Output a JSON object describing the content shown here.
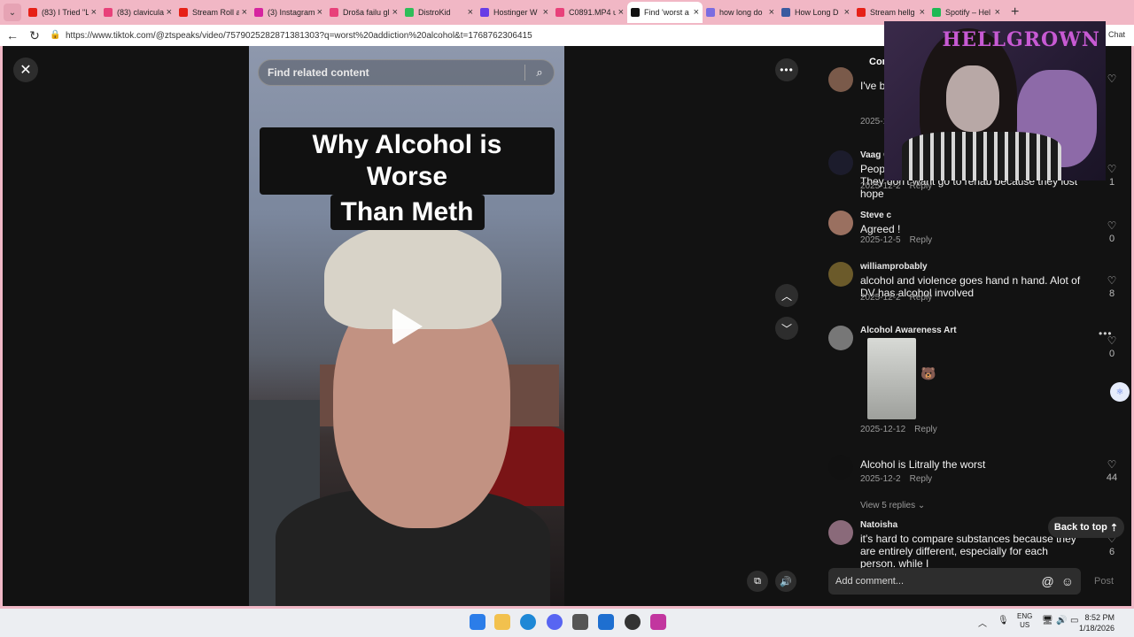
{
  "browser": {
    "tabs": [
      {
        "label": "(83) I Tried \"L",
        "color": "#e62117"
      },
      {
        "label": "(83) clavicula",
        "color": "#e8417a"
      },
      {
        "label": "Stream Roll a",
        "color": "#e62117"
      },
      {
        "label": "(3) Instagram",
        "color": "#d6249f"
      },
      {
        "label": "Droša failu gl",
        "color": "#e8417a"
      },
      {
        "label": "DistroKid",
        "color": "#2ebd59"
      },
      {
        "label": "Hostinger W",
        "color": "#673de6"
      },
      {
        "label": "C0891.MP4 u",
        "color": "#e8417a"
      },
      {
        "label": "Find 'worst a",
        "color": "#111111"
      },
      {
        "label": "how long do",
        "color": "#7b6ce0"
      },
      {
        "label": "How Long D",
        "color": "#3a5ba0"
      },
      {
        "label": "Stream hellg",
        "color": "#e62117"
      },
      {
        "label": "Spotify – Hel",
        "color": "#1db954"
      }
    ],
    "active_tab_index": 8,
    "url": "https://www.tiktok.com/@ztspeaks/video/7579025282871381303?q=worst%20addiction%20alcohol&t=1768762306415",
    "chat_label": "Chat"
  },
  "video": {
    "search_placeholder": "Find related content",
    "caption_line1": "Why Alcohol is Worse",
    "caption_line2": "Than Meth"
  },
  "comments_panel": {
    "tab_label": "Com",
    "comments": [
      {
        "user": "",
        "text": "I've be wisdo say A longe",
        "date": "2025-1",
        "reply": "",
        "likes": ""
      },
      {
        "user": "Vaag C",
        "text": "People (including myself) have sold their soul. They don't want go to rehab because they lost hope",
        "date": "2025-12-2",
        "reply": "Reply",
        "likes": "1"
      },
      {
        "user": "Steve c",
        "text": "Agreed !",
        "date": "2025-12-5",
        "reply": "Reply",
        "likes": "0"
      },
      {
        "user": "williamprobably",
        "text": "alcohol and violence goes hand n hand. Alot of DV has alcohol involved",
        "date": "2025-12-2",
        "reply": "Reply",
        "likes": "8"
      },
      {
        "user": "Alcohol Awareness Art",
        "text": "",
        "date": "2025-12-12",
        "reply": "Reply",
        "likes": "0"
      },
      {
        "user": "",
        "text": "Alcohol is Litrally the worst",
        "date": "2025-12-2",
        "reply": "Reply",
        "likes": "44"
      },
      {
        "user": "Natoisha",
        "text": "it's hard to compare substances because they are entirely different, especially for each person. while I",
        "date": "",
        "reply": "",
        "likes": "6"
      }
    ],
    "view_replies": "View 5 replies",
    "back_to_top": "Back to top",
    "add_comment_placeholder": "Add comment...",
    "post_label": "Post"
  },
  "webcam": {
    "overlay_text": "HELLGROWN"
  },
  "taskbar": {
    "lang_top": "ENG",
    "lang_bottom": "US",
    "time": "8:52 PM",
    "date": "1/18/2026"
  }
}
